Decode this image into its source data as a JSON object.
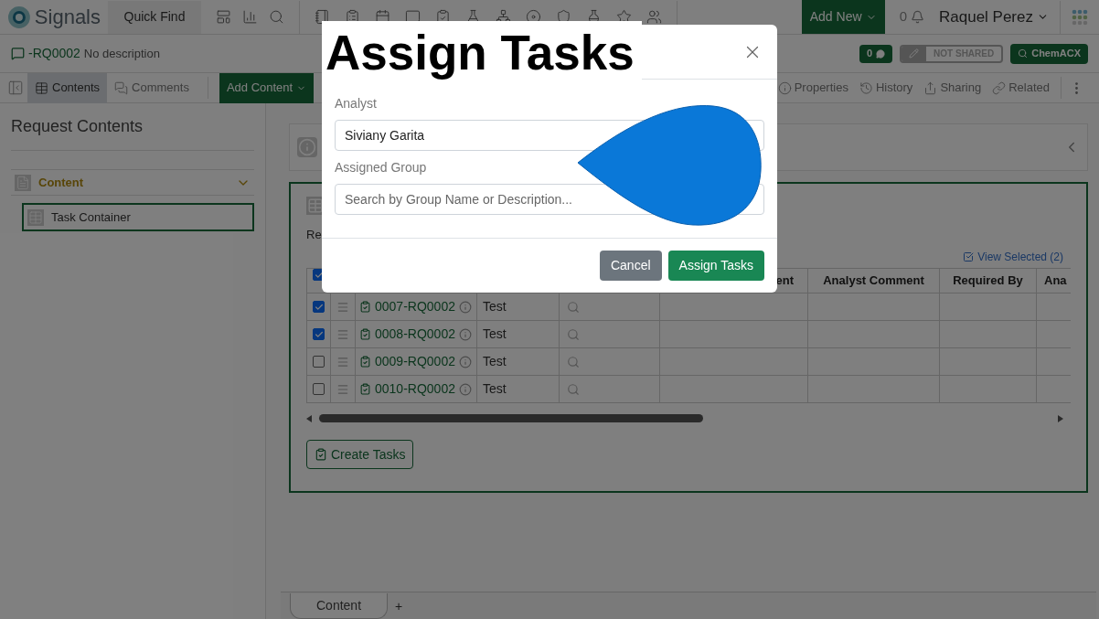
{
  "top_nav": {
    "brand": "Signals",
    "quick_find": "Quick Find",
    "add_new": "Add New",
    "notification_count": "0",
    "user": "Raquel Perez"
  },
  "record": {
    "id": "-RQ0002",
    "description": "No description",
    "comment_count": "0",
    "share_status": "NOT SHARED",
    "search_button": "ChemACX"
  },
  "toolbar": {
    "tabs": [
      {
        "label": "Contents",
        "selected": true
      },
      {
        "label": "Comments",
        "selected": false
      }
    ],
    "add_content": "Add Content",
    "actions": [
      "Properties",
      "History",
      "Sharing",
      "Related"
    ]
  },
  "sidebar": {
    "title": "Request Contents",
    "section": {
      "label": "Content",
      "expanded": true
    },
    "items": [
      {
        "label": "Task Container",
        "selected": true
      }
    ]
  },
  "container": {
    "title_fragment": "Re",
    "view_selected": "View Selected (2)",
    "select_all": {
      "checked": true
    },
    "columns": [
      "ent",
      "Analyst Comment",
      "Required By",
      "Ana"
    ],
    "rows": [
      {
        "id": "0007-RQ0002",
        "name": "Test",
        "checked": true
      },
      {
        "id": "0008-RQ0002",
        "name": "Test",
        "checked": true
      },
      {
        "id": "0009-RQ0002",
        "name": "Test",
        "checked": false
      },
      {
        "id": "0010-RQ0002",
        "name": "Test",
        "checked": false
      }
    ],
    "create_button": "Create Tasks"
  },
  "bottom_tabs": [
    {
      "label": "Content",
      "selected": true
    }
  ],
  "add_tab": "+",
  "modal": {
    "title": "Assign Tasks",
    "fields": [
      {
        "label": "Analyst",
        "kind": "select",
        "value": "Siviany Garita"
      },
      {
        "label": "Assigned Group",
        "kind": "search",
        "placeholder": "Search by Group Name or Description..."
      }
    ],
    "buttons": [
      {
        "label": "Cancel",
        "kind": "secondary"
      },
      {
        "label": "Assign Tasks",
        "kind": "primary"
      }
    ]
  }
}
